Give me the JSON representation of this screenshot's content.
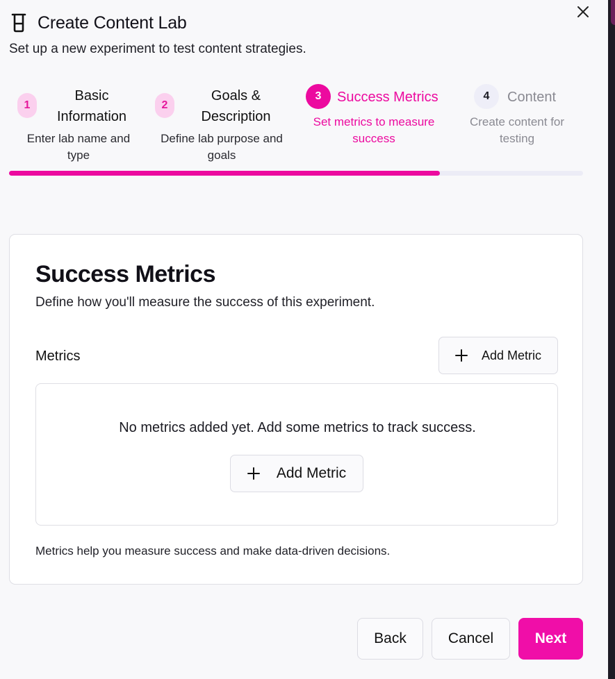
{
  "dialog": {
    "title": "Create Content Lab",
    "subtitle": "Set up a new experiment to test content strategies.",
    "icon": "beaker-icon"
  },
  "steps": [
    {
      "number": "1",
      "title_line1": "Basic",
      "title_line2": "Information",
      "desc_line1": "Enter lab name and",
      "desc_line2": "type",
      "state": "completed"
    },
    {
      "number": "2",
      "title_line1": "Goals &",
      "title_line2": "Description",
      "desc_line1": "Define lab purpose and",
      "desc_line2": "goals",
      "state": "completed"
    },
    {
      "number": "3",
      "title": "Success Metrics",
      "desc_line1": "Set metrics to measure",
      "desc_line2": "success",
      "state": "active"
    },
    {
      "number": "4",
      "title": "Content",
      "desc_line1": "Create content for",
      "desc_line2": "testing",
      "state": "upcoming"
    }
  ],
  "progress": {
    "value_percent": 75
  },
  "card": {
    "title": "Success Metrics",
    "description": "Define how you'll measure the success of this experiment.",
    "metrics_label": "Metrics",
    "add_metric_label": "Add Metric",
    "empty_message": "No metrics added yet. Add some metrics to track success.",
    "hint": "Metrics help you measure success and make data-driven decisions."
  },
  "footer": {
    "back": "Back",
    "cancel": "Cancel",
    "next": "Next"
  },
  "colors": {
    "accent": "#ec0a9f",
    "accent_light": "#fbd0ee",
    "upcoming_bg": "#eeeef8"
  }
}
